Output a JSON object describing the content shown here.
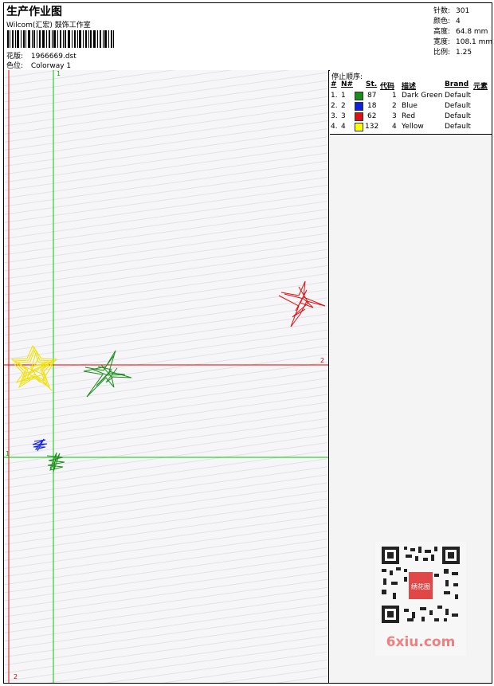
{
  "header": {
    "title": "生产作业图",
    "company": "Wilcom(汇宏) 鼓饰工作室",
    "design_label": "花版:",
    "design_value": "1966669.dst",
    "colorway_label": "色位:",
    "colorway_value": "Colorway 1"
  },
  "stats": [
    {
      "label": "针数:",
      "value": "301"
    },
    {
      "label": "颜色:",
      "value": "4"
    },
    {
      "label": "高度:",
      "value": "64.8 mm"
    },
    {
      "label": "宽度:",
      "value": "108.1 mm"
    },
    {
      "label": "比例:",
      "value": "1.25"
    }
  ],
  "stop_sequence": {
    "title": "停止顺序:",
    "columns": [
      "#",
      "N#",
      "St.",
      "代码",
      "描述",
      "Brand",
      "元素"
    ],
    "rows": [
      {
        "index": "1.",
        "n": "1",
        "stitches": "87",
        "code": "1",
        "description": "Dark Green",
        "brand": "Default",
        "color": "#1a8c1a"
      },
      {
        "index": "2.",
        "n": "2",
        "stitches": "18",
        "code": "2",
        "description": "Blue",
        "brand": "Default",
        "color": "#1020e0"
      },
      {
        "index": "3.",
        "n": "3",
        "stitches": "62",
        "code": "3",
        "description": "Red",
        "brand": "Default",
        "color": "#e01010"
      },
      {
        "index": "4.",
        "n": "4",
        "stitches": "132",
        "code": "4",
        "description": "Yellow",
        "brand": "Default",
        "color": "#ffff00"
      }
    ]
  },
  "axes": {
    "green_top_label": "1",
    "green_left_label": "1",
    "red_right_label": "2",
    "red_bottom_label": "2",
    "green_color": "#00cc00",
    "red_color": "#e00000"
  },
  "watermark": {
    "text": "6xiu.com",
    "stamp_text": "绣花图",
    "text_color": "#f08080"
  }
}
